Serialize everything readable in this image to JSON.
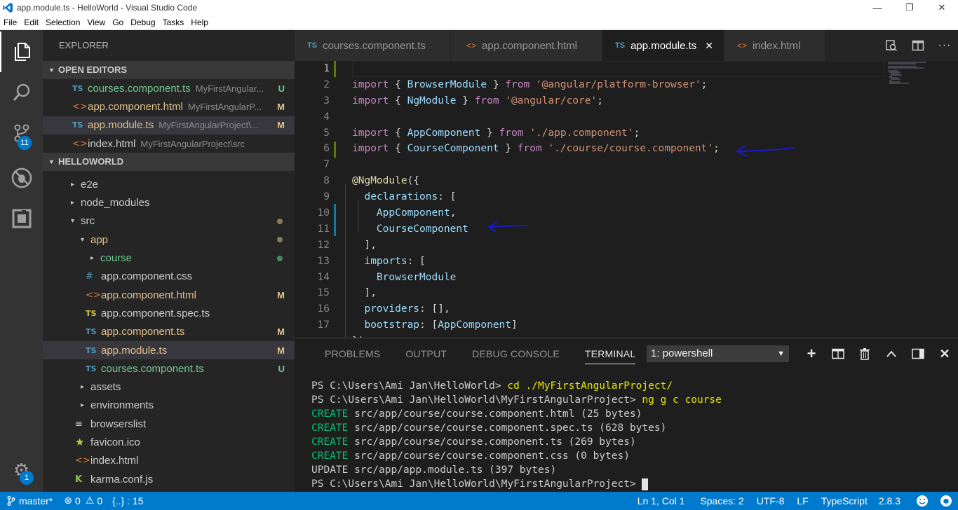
{
  "window": {
    "title": "app.module.ts - HelloWorld - Visual Studio Code",
    "minimize": "—",
    "maximize": "❐",
    "close": "✕"
  },
  "menu": [
    "File",
    "Edit",
    "Selection",
    "View",
    "Go",
    "Debug",
    "Tasks",
    "Help"
  ],
  "activity": {
    "scm_badge": "11",
    "settings_badge": "1"
  },
  "sidebar": {
    "title": "EXPLORER",
    "open_editors_header": "OPEN EDITORS",
    "open_editors": [
      {
        "icon": "TS",
        "name": "courses.component.ts",
        "path": "MyFirstAngular...",
        "flag": "U"
      },
      {
        "icon": "<>",
        "name": "app.component.html",
        "path": "MyFirstAngularP...",
        "flag": "M"
      },
      {
        "icon": "TS",
        "name": "app.module.ts",
        "path": "MyFirstAngularProject\\...",
        "flag": "M"
      },
      {
        "icon": "<>",
        "name": "index.html",
        "path": "MyFirstAngularProject\\src",
        "flag": ""
      }
    ],
    "workspace_header": "HELLOWORLD",
    "tree": [
      {
        "name": "e2e"
      },
      {
        "name": "node_modules"
      },
      {
        "name": "src"
      },
      {
        "name": "app"
      },
      {
        "name": "course"
      },
      {
        "name": "app.component.css",
        "icon": "#"
      },
      {
        "name": "app.component.html",
        "icon": "<>",
        "flag": "M"
      },
      {
        "name": "app.component.spec.ts",
        "icon": "TS"
      },
      {
        "name": "app.component.ts",
        "icon": "TS",
        "flag": "M"
      },
      {
        "name": "app.module.ts",
        "icon": "TS",
        "flag": "M"
      },
      {
        "name": "courses.component.ts",
        "icon": "TS",
        "flag": "U"
      },
      {
        "name": "assets"
      },
      {
        "name": "environments"
      },
      {
        "name": "browserslist"
      },
      {
        "name": "favicon.ico",
        "icon": "★"
      },
      {
        "name": "index.html",
        "icon": "<>"
      },
      {
        "name": "karma.conf.js",
        "icon": "K"
      }
    ]
  },
  "tabs": [
    {
      "icon": "TS",
      "label": "courses.component.ts"
    },
    {
      "icon": "<>",
      "label": "app.component.html"
    },
    {
      "icon": "TS",
      "label": "app.module.ts",
      "close": "✕"
    },
    {
      "icon": "<>",
      "label": "index.html"
    }
  ],
  "editor": {
    "line_numbers": [
      "1",
      "2",
      "3",
      "4",
      "5",
      "6",
      "7",
      "8",
      "9",
      "10",
      "11",
      "12",
      "13",
      "14",
      "15",
      "16",
      "17"
    ],
    "code": {
      "l2": [
        "import",
        " { ",
        "BrowserModule",
        " } ",
        "from",
        " ",
        "'@angular/platform-browser'",
        ";"
      ],
      "l3": [
        "import",
        " { ",
        "NgModule",
        " } ",
        "from",
        " ",
        "'@angular/core'",
        ";"
      ],
      "l5": [
        "import",
        " { ",
        "AppComponent",
        " } ",
        "from",
        " ",
        "'./app.component'",
        ";"
      ],
      "l6": [
        "import",
        " { ",
        "CourseComponent",
        " } ",
        "from",
        " ",
        "'./course/course.component'",
        ";"
      ],
      "l8": [
        "@NgModule",
        "({"
      ],
      "l9": [
        "  ",
        "declarations",
        ": ["
      ],
      "l10": [
        "    ",
        "AppComponent",
        ","
      ],
      "l11": [
        "    ",
        "CourseComponent"
      ],
      "l12": [
        "  ],"
      ],
      "l13": [
        "  ",
        "imports",
        ": ["
      ],
      "l14": [
        "    ",
        "BrowserModule"
      ],
      "l15": [
        "  ],"
      ],
      "l16": [
        "  ",
        "providers",
        ": [],"
      ],
      "l17": [
        "  ",
        "bootstrap",
        ": [",
        "AppComponent",
        "]"
      ],
      "l18": [
        "})"
      ]
    }
  },
  "panel": {
    "tabs": [
      "PROBLEMS",
      "OUTPUT",
      "DEBUG CONSOLE",
      "TERMINAL"
    ],
    "terminal_select": "1: powershell",
    "terminal": {
      "l1_prompt": "PS C:\\Users\\Ami Jan\\HelloWorld> ",
      "l1_cmd": "cd ./MyFirstAngularProject/",
      "l2_prompt": "PS C:\\Users\\Ami Jan\\HelloWorld\\MyFirstAngularProject> ",
      "l2_cmd": "ng g c course",
      "l3_tag": "CREATE",
      "l3_text": " src/app/course/course.component.html (25 bytes)",
      "l4_tag": "CREATE",
      "l4_text": " src/app/course/course.component.spec.ts (628 bytes)",
      "l5_tag": "CREATE",
      "l5_text": " src/app/course/course.component.ts (269 bytes)",
      "l6_tag": "CREATE",
      "l6_text": " src/app/course/course.component.css (0 bytes)",
      "l7_text": "UPDATE src/app/app.module.ts (397 bytes)",
      "l8_prompt": "PS C:\\Users\\Ami Jan\\HelloWorld\\MyFirstAngularProject> "
    }
  },
  "status": {
    "branch": "master*",
    "errors": "0",
    "warnings": "0",
    "braces": "{..} : 15",
    "position": "Ln 1, Col 1",
    "spaces": "Spaces: 2",
    "encoding": "UTF-8",
    "eol": "LF",
    "language": "TypeScript",
    "version": "2.8.3"
  },
  "colors": {
    "accent": "#007acc",
    "modified": "#e2c08d",
    "untracked": "#73c991",
    "annotation_arrow": "#1a1acc"
  }
}
